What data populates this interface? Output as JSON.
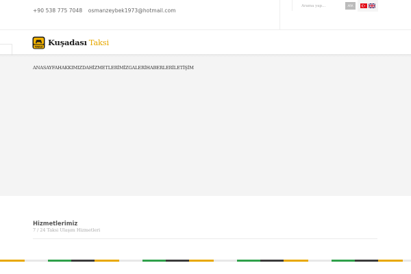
{
  "topbar": {
    "phone": "+90 538 775 7048",
    "email": "osmanzeybek1973@hotmail.com",
    "search_placeholder": "Arama yap...",
    "search_button": "ARA",
    "languages": [
      {
        "code": "tr",
        "icon": "turkey-flag-icon"
      },
      {
        "code": "en",
        "icon": "uk-flag-icon"
      }
    ]
  },
  "logo": {
    "badge": "TAKSİ",
    "text": "Kuşadası",
    "accent": "Taksi",
    "colors": {
      "taxi_yellow": "#f2b200",
      "accent_text": "#e6a800"
    }
  },
  "nav": {
    "items": [
      {
        "label": "ANASAYFA"
      },
      {
        "label": "HAKKIMIZDA"
      },
      {
        "label": "HİZMETLERİMİZ"
      },
      {
        "label": "GALERİ"
      },
      {
        "label": "HABERLER"
      },
      {
        "label": "İLETİŞİM"
      }
    ]
  },
  "section": {
    "title": "Hizmetlerimiz",
    "subtitle": "7 / 24 Taksi Ulaşım Hizmetleri"
  },
  "footer_stripe": {
    "colors": [
      "#e8a800",
      "#e8e8e8",
      "#2fa04a",
      "#3b3b3b"
    ]
  }
}
